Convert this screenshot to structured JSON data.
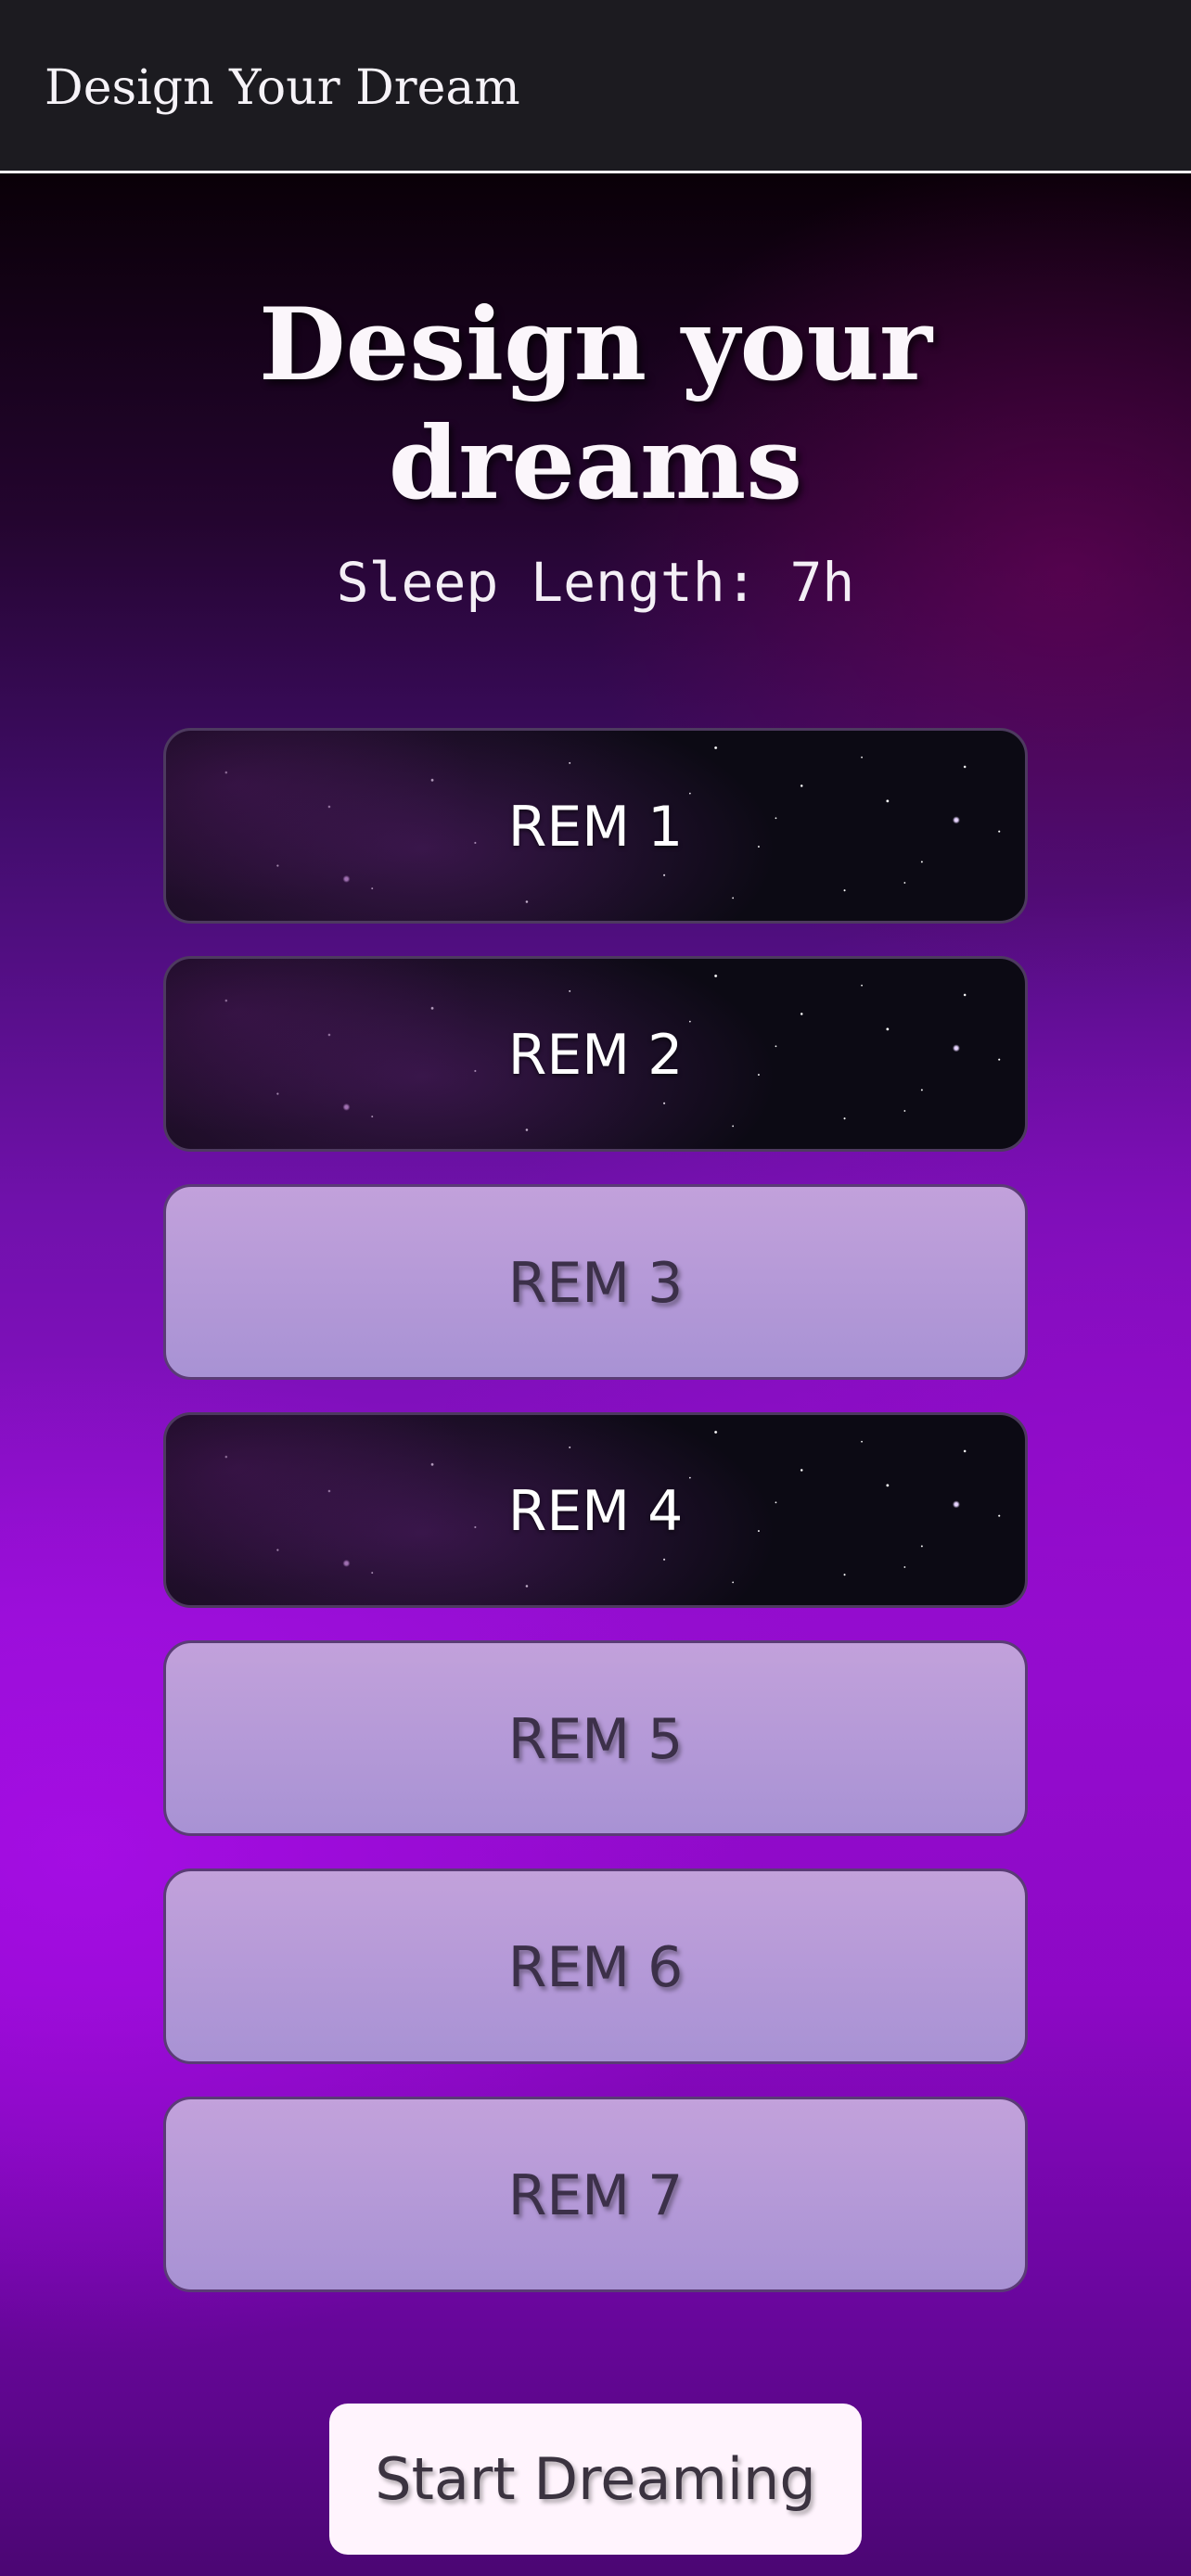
{
  "header": {
    "title": "Design Your Dream"
  },
  "main": {
    "heading": "Design your dreams",
    "sleep_length": "Sleep Length: 7h"
  },
  "rem_phases": [
    {
      "label": "REM 1",
      "style": "starry"
    },
    {
      "label": "REM 2",
      "style": "starry"
    },
    {
      "label": "REM 3",
      "style": "lavender"
    },
    {
      "label": "REM 4",
      "style": "starry"
    },
    {
      "label": "REM 5",
      "style": "lavender"
    },
    {
      "label": "REM 6",
      "style": "lavender"
    },
    {
      "label": "REM 7",
      "style": "lavender"
    }
  ],
  "actions": {
    "start_label": "Start Dreaming"
  },
  "colors": {
    "header_background": "#1c1b20",
    "card_lavender": "#b89cd8",
    "card_starry": "#0c0a14",
    "background_purple": "#930ed0",
    "button_background": "#fff4fd"
  }
}
